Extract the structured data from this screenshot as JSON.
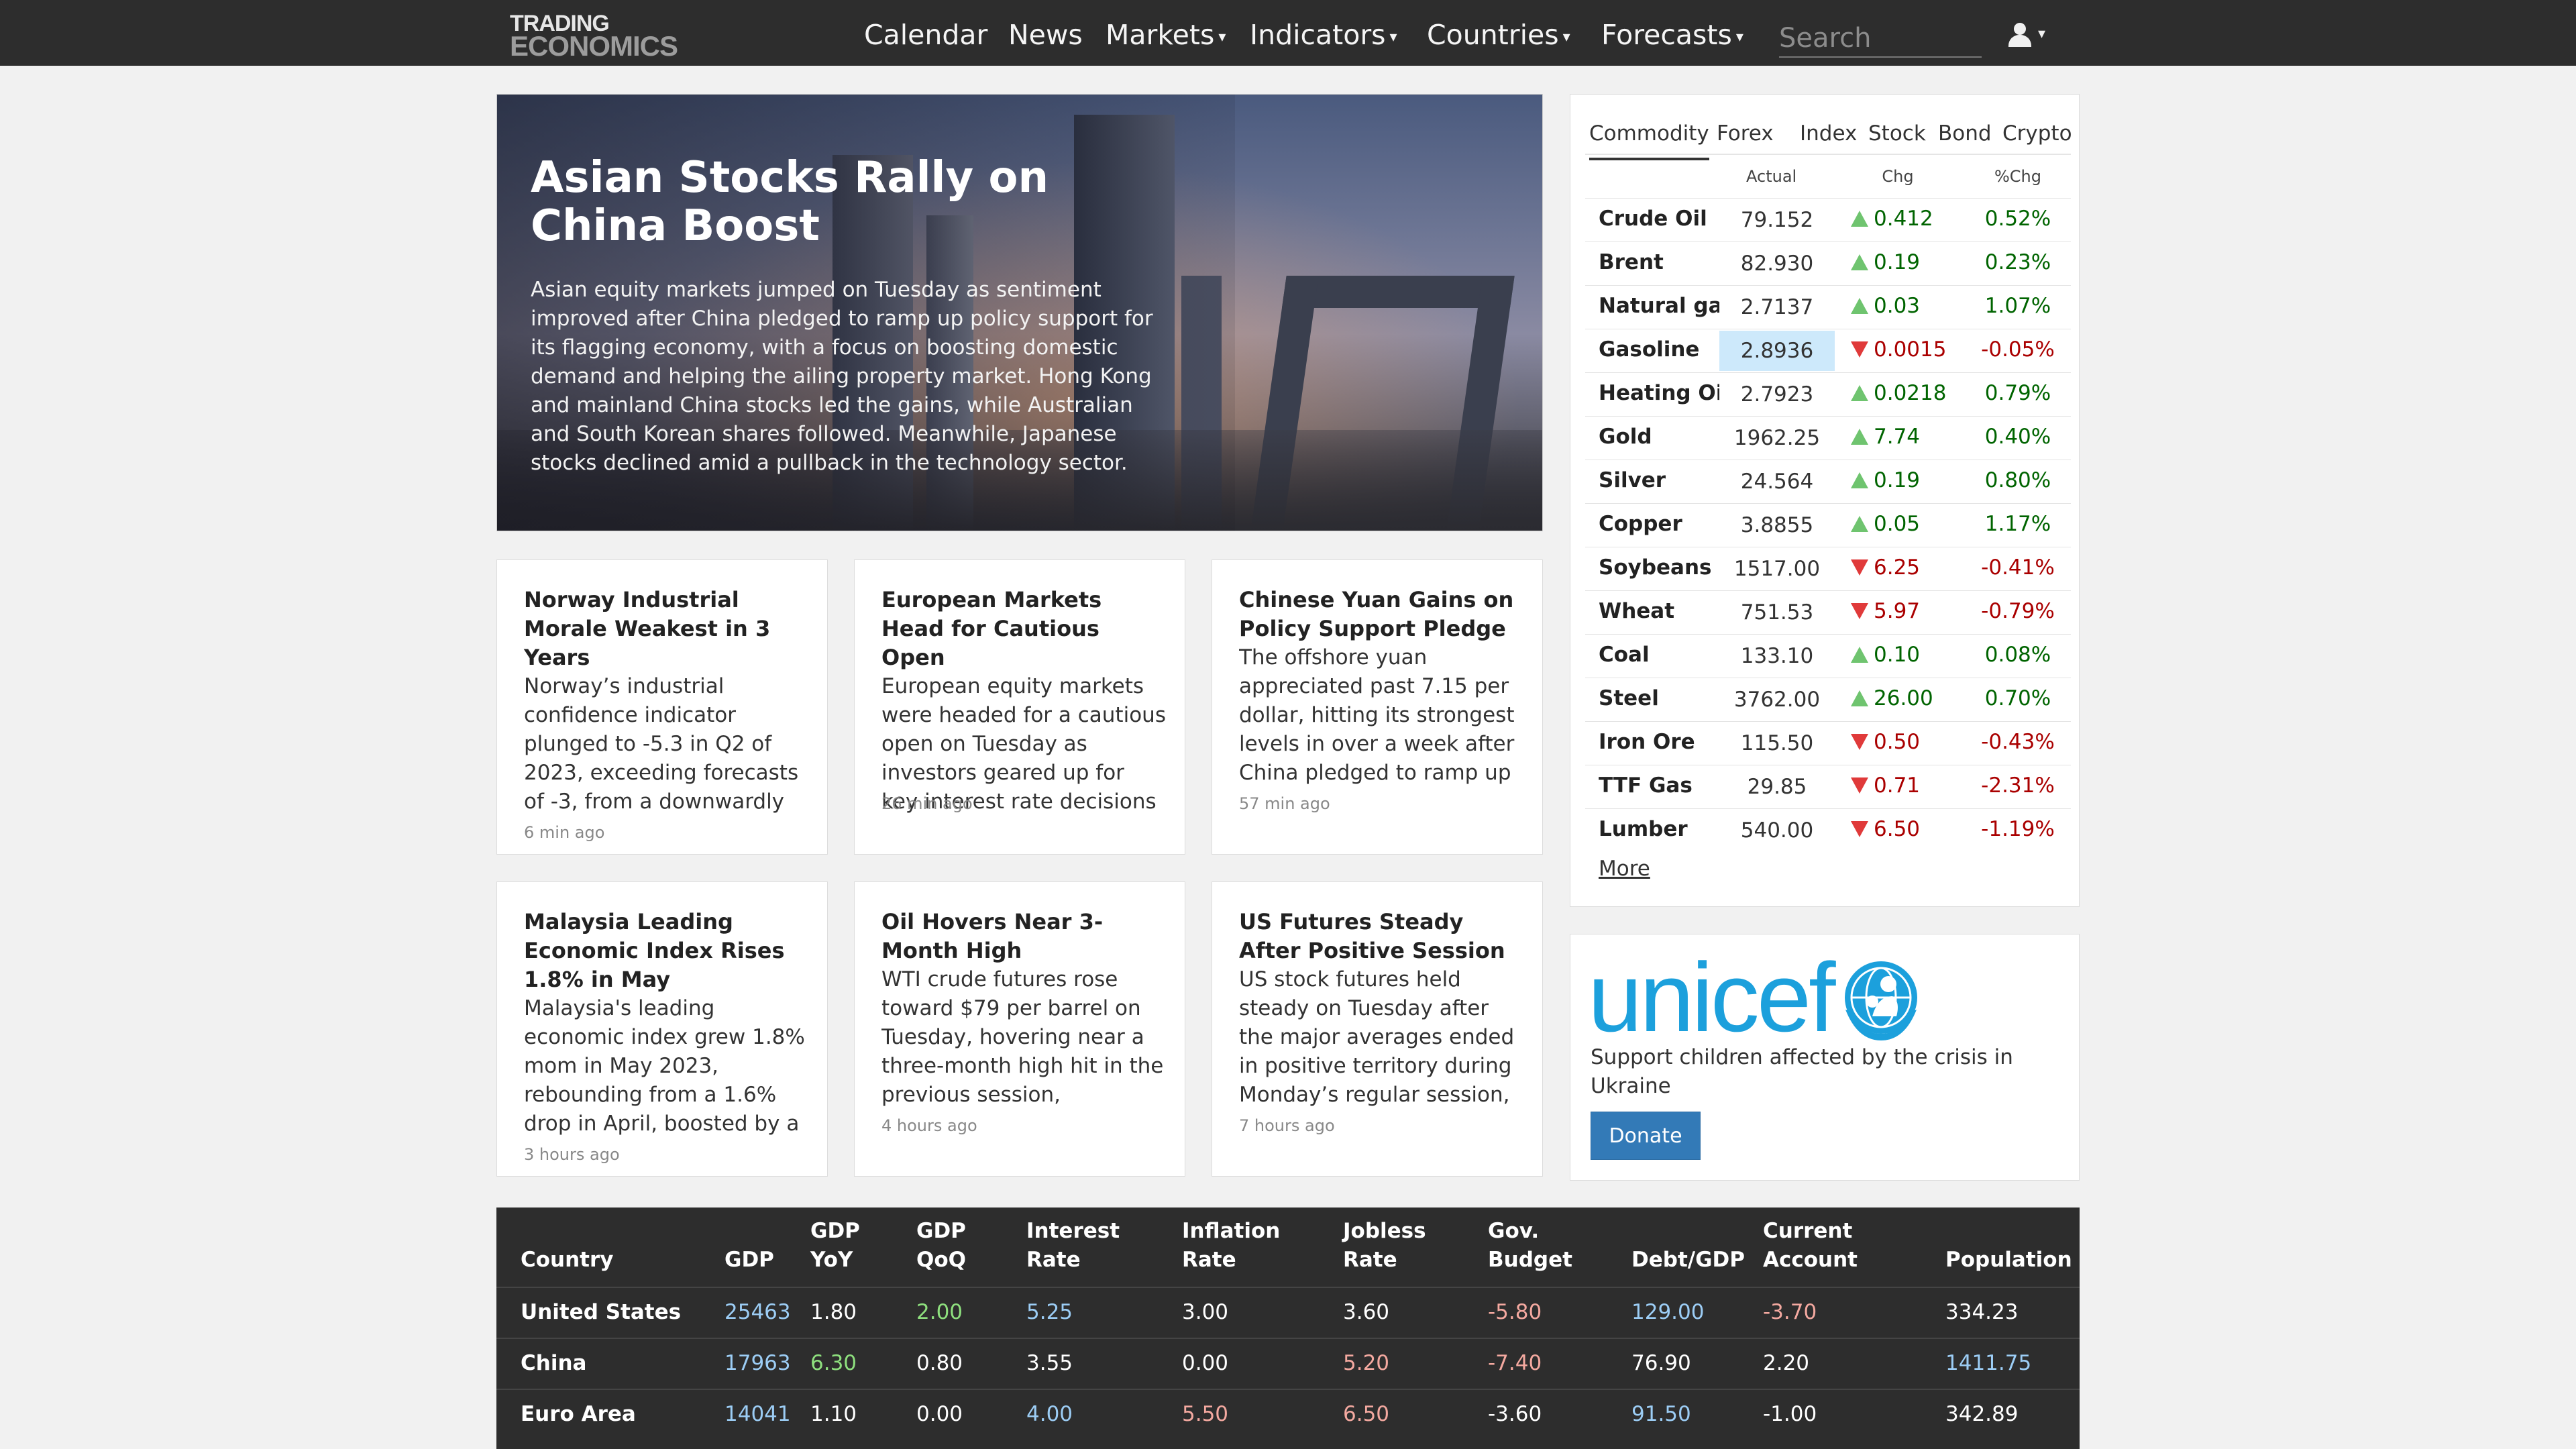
{
  "brand": {
    "line1": "TRADING",
    "line2": "ECONOMICS"
  },
  "nav": {
    "items": [
      {
        "label": "Calendar"
      },
      {
        "label": "News"
      },
      {
        "label": "Markets"
      },
      {
        "label": "Indicators"
      },
      {
        "label": "Countries"
      },
      {
        "label": "Forecasts"
      }
    ],
    "search_placeholder": "Search",
    "user_icon": "user-icon"
  },
  "hero": {
    "title": "Asian Stocks Rally on China Boost",
    "text": "Asian equity markets jumped on Tuesday as sentiment improved after China pledged to ramp up policy support for its flagging economy, with a focus on boosting domestic demand and helping the ailing property market. Hong Kong and mainland China stocks led the gains, while Australian and South Korean shares followed. Meanwhile, Japanese stocks declined amid a pullback in the technology sector."
  },
  "news": [
    {
      "title": "Norway Industrial Morale Weakest in 3 Years",
      "body": "Norway’s industrial confidence indicator plunged to -5.3 in Q2 of 2023, exceeding forecasts of -3, from a downwardly",
      "time": "6 min ago"
    },
    {
      "title": "European Markets Head for Cautious Open",
      "body": "European equity markets were headed for a cautious open on Tuesday as investors geared up for key interest rate decisions from",
      "time": "26 min ago"
    },
    {
      "title": "Chinese Yuan Gains on Policy Support Pledge",
      "body": "The offshore yuan appreciated past 7.15 per dollar, hitting its strongest levels in over a week after China pledged to ramp up",
      "time": "57 min ago"
    },
    {
      "title": "Malaysia Leading Economic Index Rises 1.8% in May",
      "body": "Malaysia's leading economic index grew 1.8% mom in May 2023, rebounding from a 1.6% drop in April, boosted by a",
      "time": "3 hours ago"
    },
    {
      "title": "Oil Hovers Near 3-Month High",
      "body": "WTI crude futures rose toward $79 per barrel on Tuesday, hovering near a three-month high hit in the previous session,",
      "time": "4 hours ago"
    },
    {
      "title": "US Futures Steady After Positive Session",
      "body": "US stock futures held steady on Tuesday after the major averages ended in positive territory during Monday’s regular session,",
      "time": "7 hours ago"
    }
  ],
  "markets": {
    "tabs": [
      "Commodity",
      "Forex",
      "Index",
      "Stock",
      "Bond",
      "Crypto"
    ],
    "active_tab": "Commodity",
    "columns": [
      "Actual",
      "Chg",
      "%Chg"
    ],
    "colors": {
      "up": "#6fc46f",
      "down": "#e03a3a",
      "pos_text": "#006400",
      "neg_text": "#a00000",
      "highlight": "#cde9fb"
    },
    "rows": [
      {
        "name": "Crude Oil",
        "actual": "79.152",
        "dir": "up",
        "chg": "0.412",
        "pct": "0.52%"
      },
      {
        "name": "Brent",
        "actual": "82.930",
        "dir": "up",
        "chg": "0.19",
        "pct": "0.23%"
      },
      {
        "name": "Natural ga",
        "actual": "2.7137",
        "dir": "up",
        "chg": "0.03",
        "pct": "1.07%"
      },
      {
        "name": "Gasoline",
        "actual": "2.8936",
        "dir": "down",
        "chg": "0.0015",
        "pct": "-0.05%",
        "highlight": true
      },
      {
        "name": "Heating Oi",
        "actual": "2.7923",
        "dir": "up",
        "chg": "0.0218",
        "pct": "0.79%"
      },
      {
        "name": "Gold",
        "actual": "1962.25",
        "dir": "up",
        "chg": "7.74",
        "pct": "0.40%"
      },
      {
        "name": "Silver",
        "actual": "24.564",
        "dir": "up",
        "chg": "0.19",
        "pct": "0.80%"
      },
      {
        "name": "Copper",
        "actual": "3.8855",
        "dir": "up",
        "chg": "0.05",
        "pct": "1.17%"
      },
      {
        "name": "Soybeans",
        "actual": "1517.00",
        "dir": "down",
        "chg": "6.25",
        "pct": "-0.41%"
      },
      {
        "name": "Wheat",
        "actual": "751.53",
        "dir": "down",
        "chg": "5.97",
        "pct": "-0.79%"
      },
      {
        "name": "Coal",
        "actual": "133.10",
        "dir": "up",
        "chg": "0.10",
        "pct": "0.08%"
      },
      {
        "name": "Steel",
        "actual": "3762.00",
        "dir": "up",
        "chg": "26.00",
        "pct": "0.70%"
      },
      {
        "name": "Iron Ore",
        "actual": "115.50",
        "dir": "down",
        "chg": "0.50",
        "pct": "-0.43%"
      },
      {
        "name": "TTF Gas",
        "actual": "29.85",
        "dir": "down",
        "chg": "0.71",
        "pct": "-2.31%"
      },
      {
        "name": "Lumber",
        "actual": "540.00",
        "dir": "down",
        "chg": "6.50",
        "pct": "-1.19%"
      }
    ],
    "more_label": "More"
  },
  "unicef": {
    "logo_text": "unicef",
    "emblem_icon": "unicef-emblem-icon",
    "brand_color": "#1ca0dc",
    "text": "Support children affected by the crisis in Ukraine",
    "button_label": "Donate"
  },
  "countries": {
    "headers": [
      [
        "Country"
      ],
      [
        "GDP"
      ],
      [
        "GDP",
        "YoY"
      ],
      [
        "GDP",
        "QoQ"
      ],
      [
        "Interest",
        "Rate"
      ],
      [
        "Inflation",
        "Rate"
      ],
      [
        "Jobless",
        "Rate"
      ],
      [
        "Gov.",
        "Budget"
      ],
      [
        "Debt/GDP"
      ],
      [
        "Current",
        "Account"
      ],
      [
        "Population"
      ]
    ],
    "rows": [
      {
        "cells": [
          {
            "v": "United States"
          },
          {
            "v": "25463",
            "c": "blue"
          },
          {
            "v": "1.80"
          },
          {
            "v": "2.00",
            "c": "green"
          },
          {
            "v": "5.25",
            "c": "blue"
          },
          {
            "v": "3.00"
          },
          {
            "v": "3.60"
          },
          {
            "v": "-5.80",
            "c": "red"
          },
          {
            "v": "129.00",
            "c": "blue"
          },
          {
            "v": "-3.70",
            "c": "red"
          },
          {
            "v": "334.23"
          }
        ]
      },
      {
        "cells": [
          {
            "v": "China"
          },
          {
            "v": "17963",
            "c": "blue"
          },
          {
            "v": "6.30",
            "c": "green"
          },
          {
            "v": "0.80"
          },
          {
            "v": "3.55"
          },
          {
            "v": "0.00"
          },
          {
            "v": "5.20",
            "c": "red"
          },
          {
            "v": "-7.40",
            "c": "red"
          },
          {
            "v": "76.90"
          },
          {
            "v": "2.20"
          },
          {
            "v": "1411.75",
            "c": "blue"
          }
        ]
      },
      {
        "cells": [
          {
            "v": "Euro Area"
          },
          {
            "v": "14041",
            "c": "blue"
          },
          {
            "v": "1.10"
          },
          {
            "v": "0.00"
          },
          {
            "v": "4.00",
            "c": "blue"
          },
          {
            "v": "5.50",
            "c": "red"
          },
          {
            "v": "6.50",
            "c": "red"
          },
          {
            "v": "-3.60"
          },
          {
            "v": "91.50",
            "c": "blue"
          },
          {
            "v": "-1.00"
          },
          {
            "v": "342.89"
          }
        ]
      }
    ]
  }
}
